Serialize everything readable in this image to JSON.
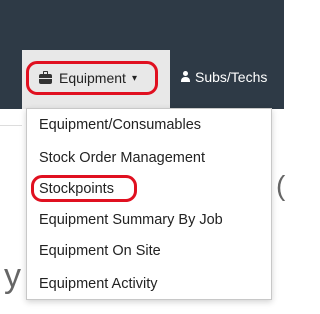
{
  "navbar": {
    "equipment_label": "Equipment",
    "equipment_caret": "▾",
    "equipment_icon": "briefcase-icon",
    "subs_label": "Subs/Techs",
    "subs_icon": "user-icon"
  },
  "dropdown": {
    "items": [
      {
        "label": "Equipment/Consumables"
      },
      {
        "label": "Stock Order Management"
      },
      {
        "label": "Stockpoints"
      },
      {
        "label": "Equipment Summary By Job"
      },
      {
        "label": "Equipment On Site"
      },
      {
        "label": "Equipment Activity"
      }
    ]
  },
  "background": {
    "partial_letter_y": "y",
    "partial_letter_c": "("
  },
  "colors": {
    "navbar": "#2e3a46",
    "highlight": "#e01020",
    "active_tab": "#e8e8e8"
  }
}
